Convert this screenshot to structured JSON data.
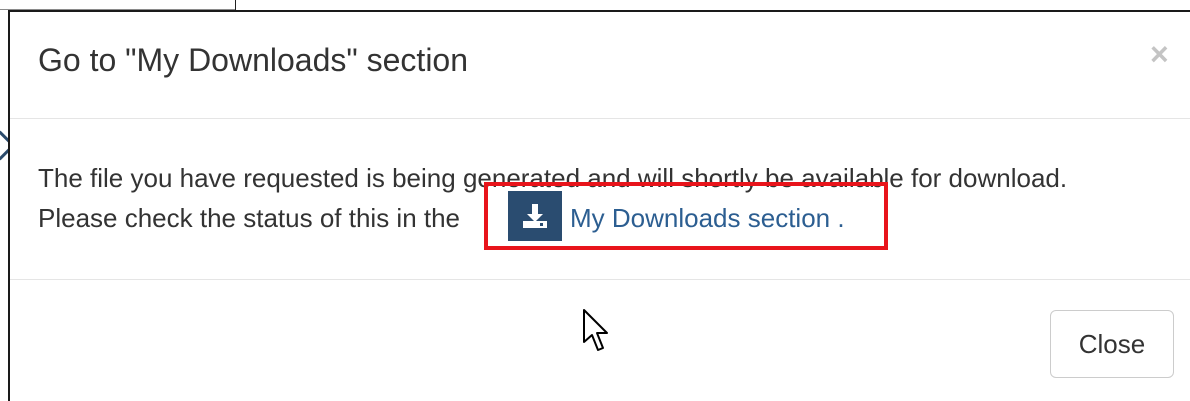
{
  "modal": {
    "title": "Go to \"My Downloads\" section",
    "close_glyph": "×",
    "body": {
      "line1": "The file you have requested is being generated and will shortly be available for download.",
      "line2_prefix": "Please check the status of this in the",
      "link_label": "My Downloads section",
      "link_suffix": "."
    },
    "footer": {
      "close_label": "Close"
    }
  },
  "icons": {
    "download": "download-icon",
    "close": "close-icon",
    "cursor": "mouse-pointer-icon",
    "chevron": "chevron-right-icon"
  },
  "colors": {
    "badge_bg": "#2a4c70",
    "link": "#2c5e91",
    "highlight": "#e8141b",
    "text": "#333333"
  }
}
